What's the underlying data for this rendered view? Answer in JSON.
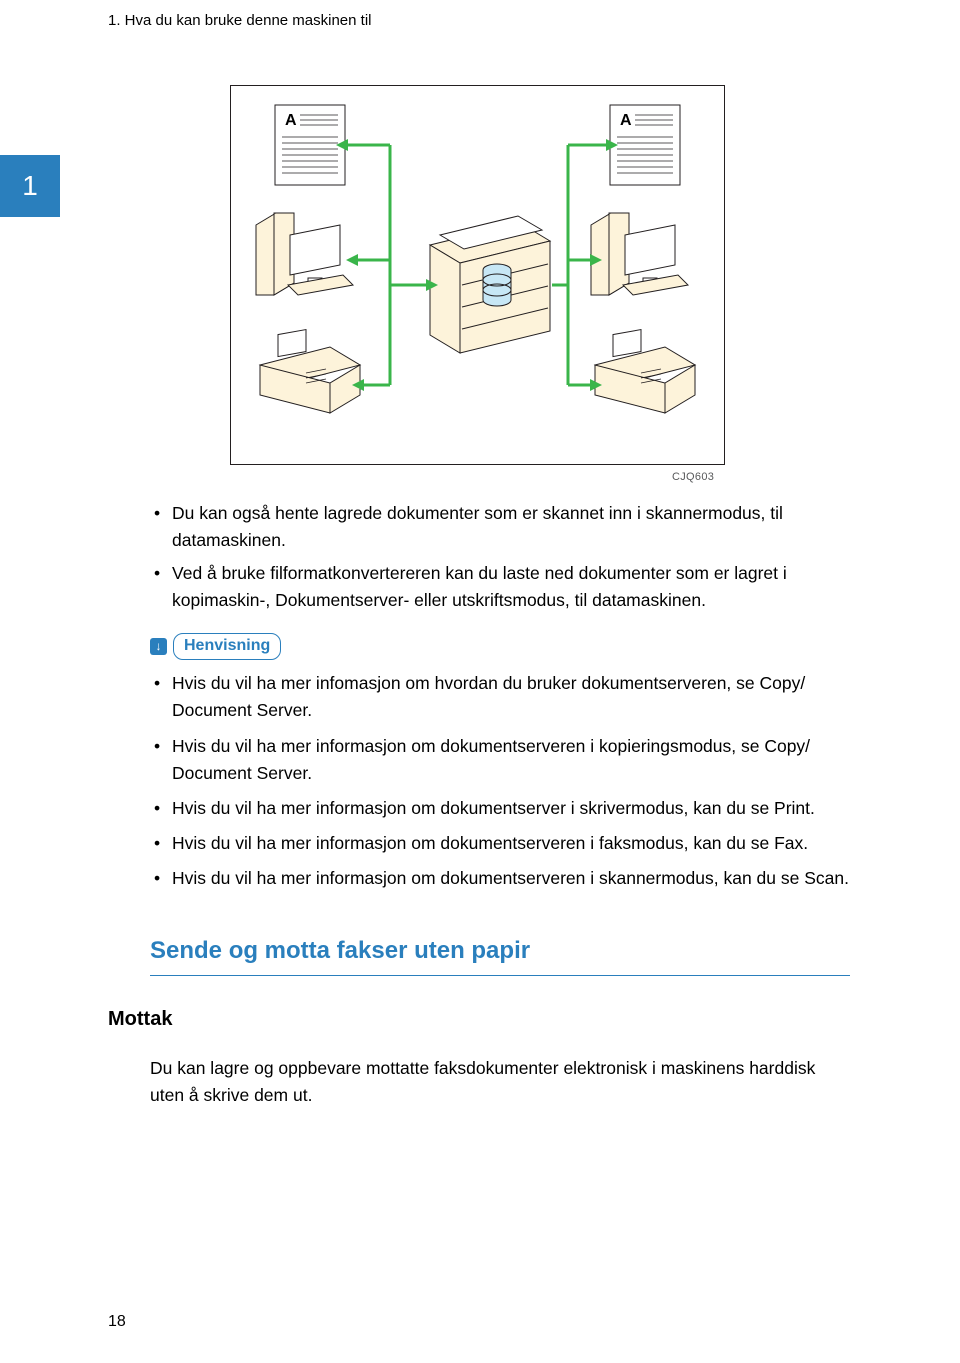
{
  "header": "1. Hva du kan bruke denne maskinen til",
  "chapter_tab": "1",
  "figure_code": "CJQ603",
  "diagram_labels": {
    "doc_letter_left": "A",
    "doc_letter_right": "A"
  },
  "bullets_intro": [
    "Du kan også hente lagrede dokumenter som er skannet inn i skannermodus, til datamaskinen.",
    "Ved å bruke filformatkonvertereren kan du laste ned dokumenter som er lagret i kopimaskin-, Dokumentserver- eller utskriftsmodus, til datamaskinen."
  ],
  "reference_label": "Henvisning",
  "reference_items": [
    "Hvis du vil ha mer infomasjon om hvordan du bruker dokumentserveren, se Copy/ Document Server.",
    "Hvis du vil ha mer informasjon om dokumentserveren i kopieringsmodus, se Copy/ Document Server.",
    "Hvis du vil ha mer informasjon om dokumentserver i skrivermodus, kan du se Print.",
    "Hvis du vil ha mer informasjon om dokumentserveren i faksmodus, kan du se Fax.",
    "Hvis du vil ha mer informasjon om dokumentserveren i skannermodus, kan du se Scan."
  ],
  "section_heading": "Sende og motta fakser uten papir",
  "section_subheading": "Mottak",
  "section_body": "Du kan lagre og oppbevare mottatte faksdokumenter elektronisk i maskinens harddisk uten å skrive dem ut.",
  "page_number": "18"
}
